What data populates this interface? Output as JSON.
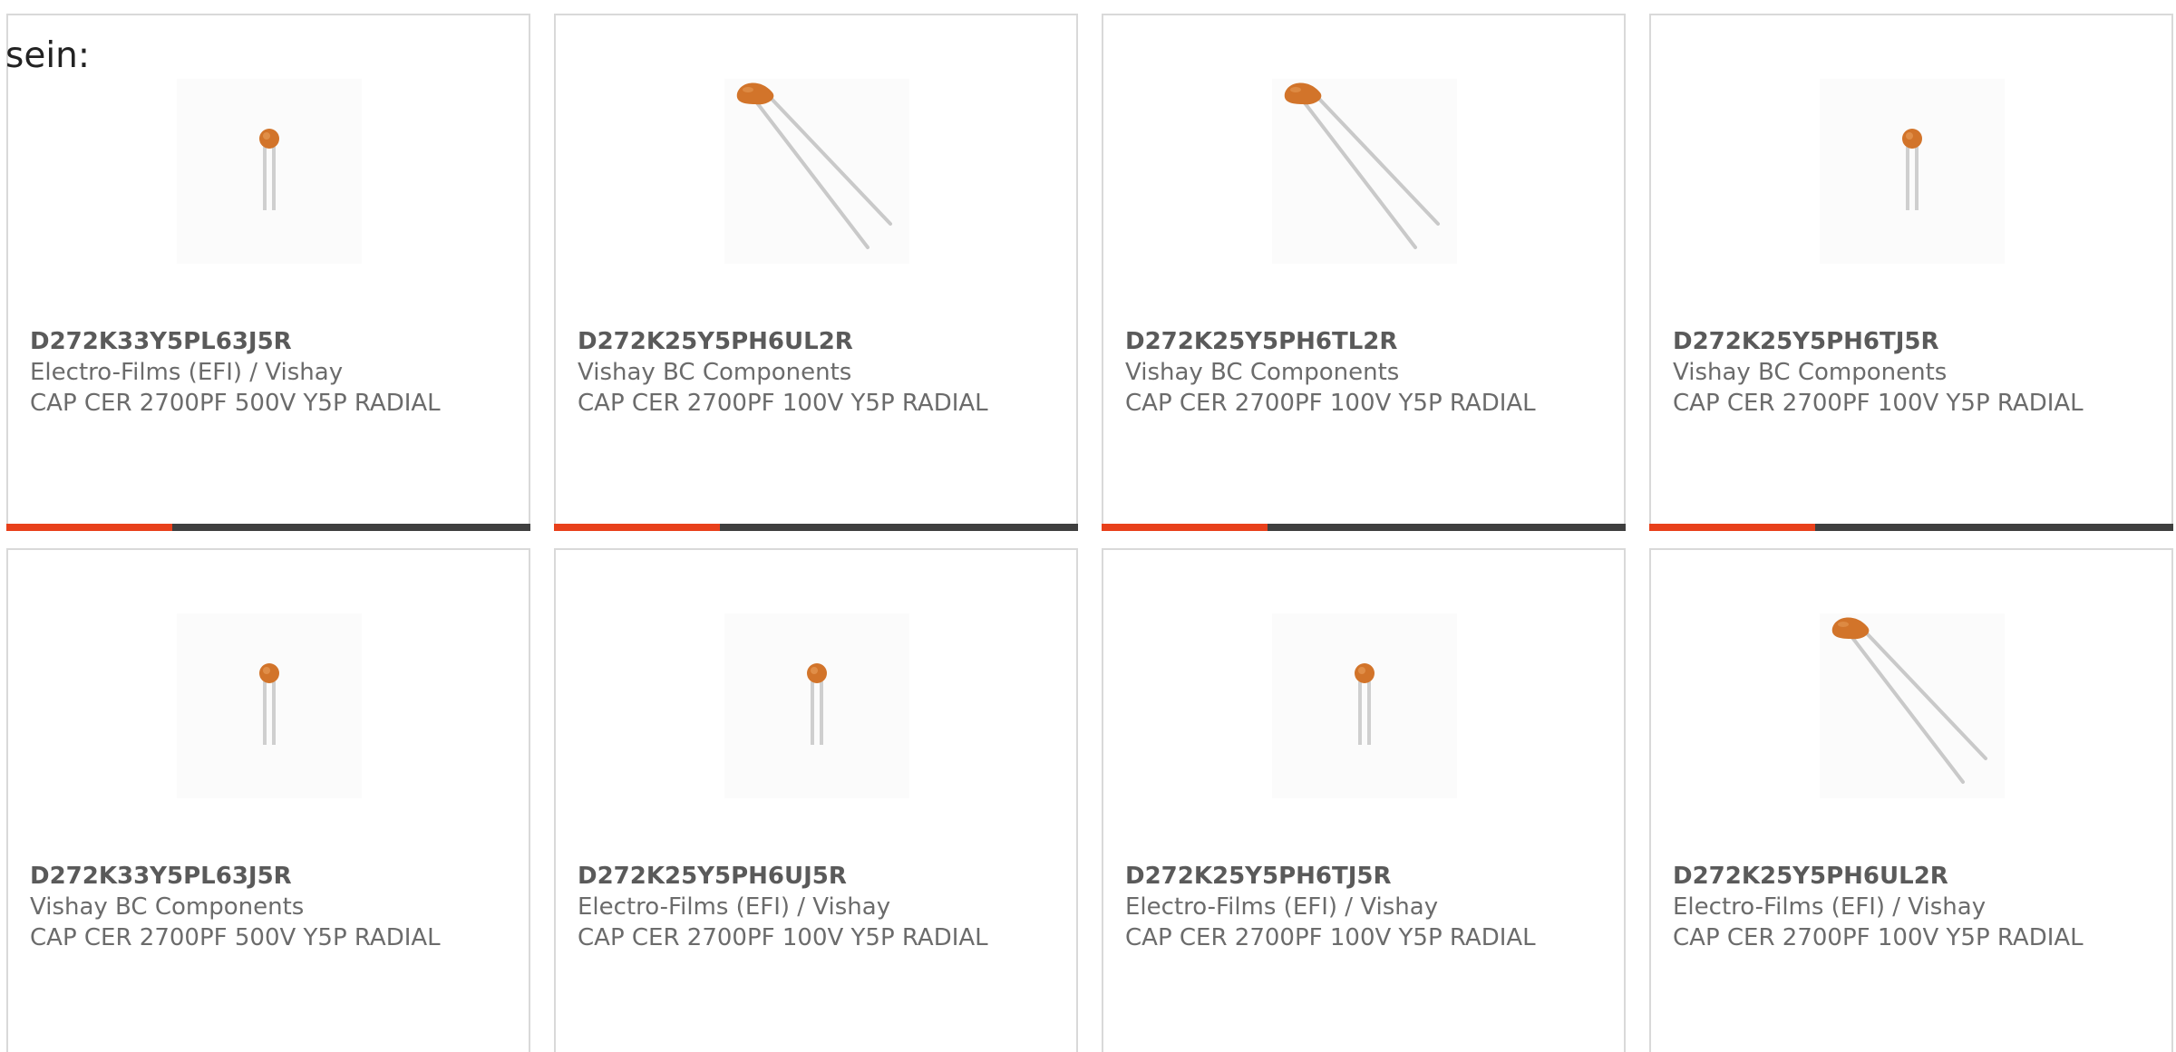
{
  "lead_text": "sein:",
  "colors": {
    "accent": "#e8401b",
    "bar_track": "#3f3f3f",
    "card_border": "#d9d9d9",
    "text": "#6b6b6b",
    "capacitor_body": "#d2742a"
  },
  "cards": [
    {
      "part_number": "D272K33Y5PL63J5R",
      "manufacturer": "Electro-Films (EFI) / Vishay",
      "description": "CAP CER 2700PF 500V Y5P RADIAL",
      "image_icon": "capacitor-upright-icon",
      "progress": 0.316
    },
    {
      "part_number": "D272K25Y5PH6UL2R",
      "manufacturer": "Vishay BC Components",
      "description": "CAP CER 2700PF 100V Y5P RADIAL",
      "image_icon": "capacitor-angled-icon",
      "progress": 0.316
    },
    {
      "part_number": "D272K25Y5PH6TL2R",
      "manufacturer": "Vishay BC Components",
      "description": "CAP CER 2700PF 100V Y5P RADIAL",
      "image_icon": "capacitor-angled-icon",
      "progress": 0.316
    },
    {
      "part_number": "D272K25Y5PH6TJ5R",
      "manufacturer": "Vishay BC Components",
      "description": "CAP CER 2700PF 100V Y5P RADIAL",
      "image_icon": "capacitor-upright-icon",
      "progress": 0.316
    },
    {
      "part_number": "D272K33Y5PL63J5R",
      "manufacturer": "Vishay BC Components",
      "description": "CAP CER 2700PF 500V Y5P RADIAL",
      "image_icon": "capacitor-upright-icon"
    },
    {
      "part_number": "D272K25Y5PH6UJ5R",
      "manufacturer": "Electro-Films (EFI) / Vishay",
      "description": "CAP CER 2700PF 100V Y5P RADIAL",
      "image_icon": "capacitor-upright-icon"
    },
    {
      "part_number": "D272K25Y5PH6TJ5R",
      "manufacturer": "Electro-Films (EFI) / Vishay",
      "description": "CAP CER 2700PF 100V Y5P RADIAL",
      "image_icon": "capacitor-upright-icon"
    },
    {
      "part_number": "D272K25Y5PH6UL2R",
      "manufacturer": "Electro-Films (EFI) / Vishay",
      "description": "CAP CER 2700PF 100V Y5P RADIAL",
      "image_icon": "capacitor-angled-icon"
    }
  ]
}
